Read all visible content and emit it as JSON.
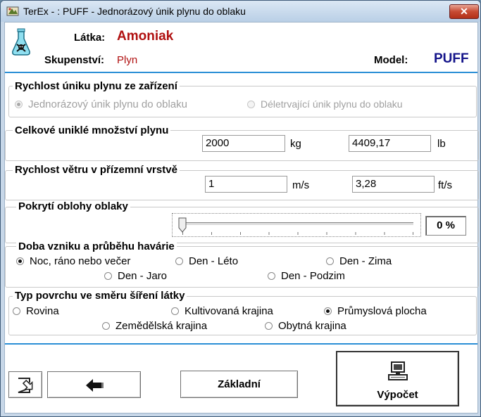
{
  "window": {
    "title": "TerEx - : PUFF - Jednorázový únik plynu do oblaku",
    "close_glyph": "✕"
  },
  "header": {
    "substance_label": "Látka:",
    "substance_value": "Amoniak",
    "phase_label": "Skupenství:",
    "phase_value": "Plyn",
    "model_label": "Model:",
    "model_value": "PUFF"
  },
  "release_rate": {
    "title": "Rychlost úniku plynu ze zařízení",
    "options": [
      {
        "label": "Jednorázový únik plynu do oblaku",
        "selected": true,
        "enabled": false
      },
      {
        "label": "Déletrvající únik plynu do oblaku",
        "selected": false,
        "enabled": false
      }
    ]
  },
  "total_amount": {
    "title": "Celkové uniklé množství plynu",
    "value_kg": "2000",
    "unit_kg": "kg",
    "value_lb": "4409,17",
    "unit_lb": "lb"
  },
  "wind_speed": {
    "title": "Rychlost větru v přízemní vrstvě",
    "value_ms": "1",
    "unit_ms": "m/s",
    "value_fts": "3,28",
    "unit_fts": "ft/s"
  },
  "cloud_cover": {
    "title": "Pokrytí oblohy oblaky",
    "value_fraction": 0,
    "display": "0 %"
  },
  "time_of_event": {
    "title": "Doba vzniku a průběhu havárie",
    "options": [
      {
        "label": "Noc, ráno nebo večer",
        "selected": true
      },
      {
        "label": "Den - Léto",
        "selected": false
      },
      {
        "label": "Den - Zima",
        "selected": false
      },
      {
        "label": "Den - Jaro",
        "selected": false
      },
      {
        "label": "Den - Podzim",
        "selected": false
      }
    ]
  },
  "surface_type": {
    "title": "Typ povrchu ve směru šíření látky",
    "options": [
      {
        "label": "Rovina",
        "selected": false
      },
      {
        "label": "Kultivovaná krajina",
        "selected": false
      },
      {
        "label": "Průmyslová plocha",
        "selected": true
      },
      {
        "label": "Zemědělská krajina",
        "selected": false
      },
      {
        "label": "Obytná krajina",
        "selected": false
      }
    ]
  },
  "buttons": {
    "exit_icon": "exit-icon",
    "back_icon": "back-arrow-icon",
    "basic_label": "Základní",
    "calculate_label": "Výpočet",
    "calculate_icon": "computer-icon"
  }
}
